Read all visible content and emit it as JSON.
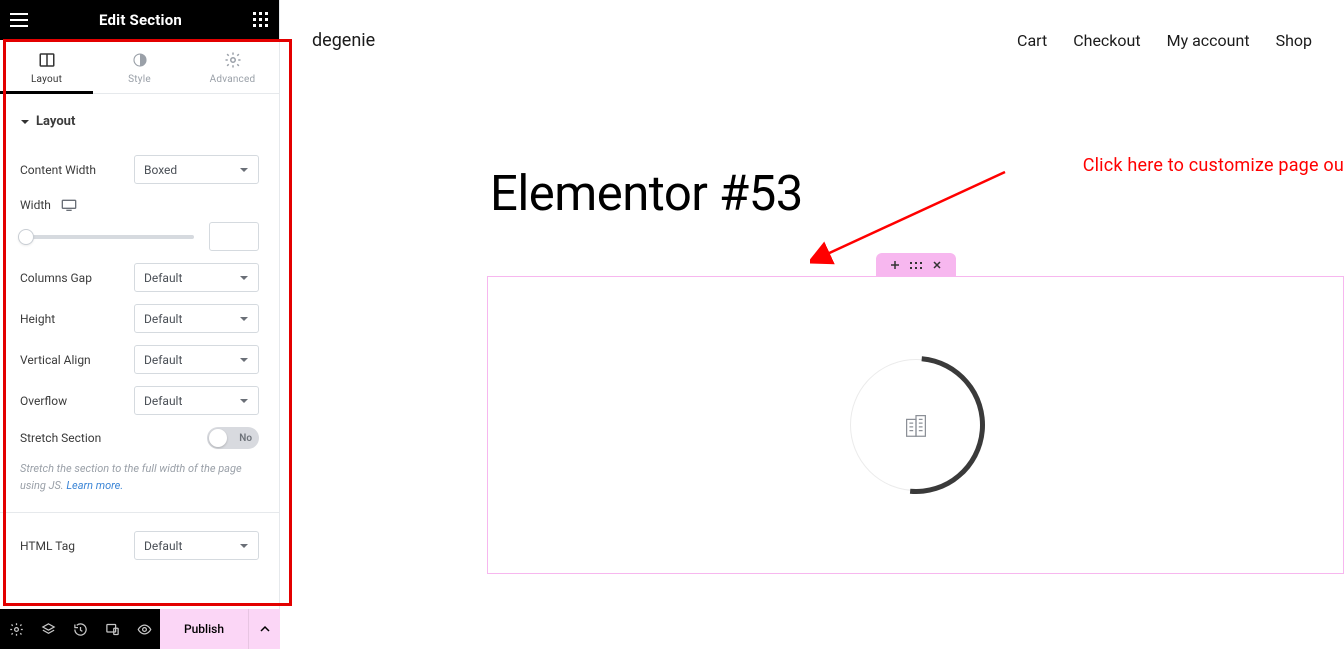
{
  "panel": {
    "title": "Edit Section",
    "tabs": {
      "layout": "Layout",
      "style": "Style",
      "advanced": "Advanced"
    },
    "accordion_title": "Layout",
    "content_width": {
      "label": "Content Width",
      "value": "Boxed"
    },
    "width": {
      "label": "Width",
      "value": ""
    },
    "columns_gap": {
      "label": "Columns Gap",
      "value": "Default"
    },
    "height": {
      "label": "Height",
      "value": "Default"
    },
    "vertical_align": {
      "label": "Vertical Align",
      "value": "Default"
    },
    "overflow": {
      "label": "Overflow",
      "value": "Default"
    },
    "stretch": {
      "label": "Stretch Section",
      "value": "No"
    },
    "stretch_hint": "Stretch the section to the full width of the page using JS. ",
    "stretch_link": "Learn more.",
    "html_tag": {
      "label": "HTML Tag",
      "value": "Default"
    }
  },
  "footer": {
    "publish": "Publish"
  },
  "page": {
    "brand": "degenie",
    "nav": [
      "Cart",
      "Checkout",
      "My account",
      "Shop"
    ],
    "title": "Elementor #53",
    "annotation": "Click here to customize page ou"
  }
}
